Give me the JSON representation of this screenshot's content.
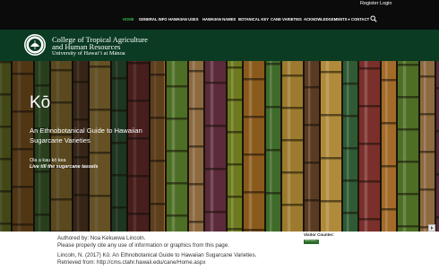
{
  "topbar": {
    "register": "Register",
    "login": "Login"
  },
  "nav": {
    "items": [
      {
        "label": "HOME",
        "active": true
      },
      {
        "label": "GENERAL INFO",
        "active": false
      },
      {
        "label": "HAWAIIAN USES",
        "active": false
      },
      {
        "label": "HAWAIIAN NAMES",
        "active": false
      },
      {
        "label": "BOTANICAL KEY",
        "active": false
      },
      {
        "label": "CANE VARIETIES",
        "active": false
      },
      {
        "label": "ACKNOWLEDGEMENTS ▾",
        "active": false
      },
      {
        "label": "CONTACT",
        "active": false
      }
    ],
    "search_icon": "search-icon"
  },
  "header": {
    "college_line1": "College of Tropical Agriculture",
    "college_line2": "and Human Resources",
    "university": "University of Hawai‘i at Mānoa",
    "logo_icon": "ctahr-seal-icon"
  },
  "hero": {
    "title": "Kō",
    "subtitle": "An Ethnobotanical Guide to Hawaiian Sugarcane Varieties",
    "proverb": "Ola a kau kō kea",
    "translation": "Live till the sugarcane tassels"
  },
  "footer": {
    "author": "Authored by: Noa Kekuewa Lincoln.",
    "cite_note": "Please properly cite any use of information or graphics from this page.",
    "citation": "Lincoln, N. (2017) Kō: An Ethnobotanical Guide to Hawaiian Sugarcane Varieties.",
    "retrieved": "Retrieved from: http://cms.ctahr.hawaii.edu/cane/Home.aspx",
    "visitor_label": "Visitor Counter:",
    "visitor_count": "0003217"
  },
  "colors": {
    "active_nav": "#36b54a",
    "header_bg": "#0b3b22",
    "topbar_bg": "#0b0b0b"
  }
}
